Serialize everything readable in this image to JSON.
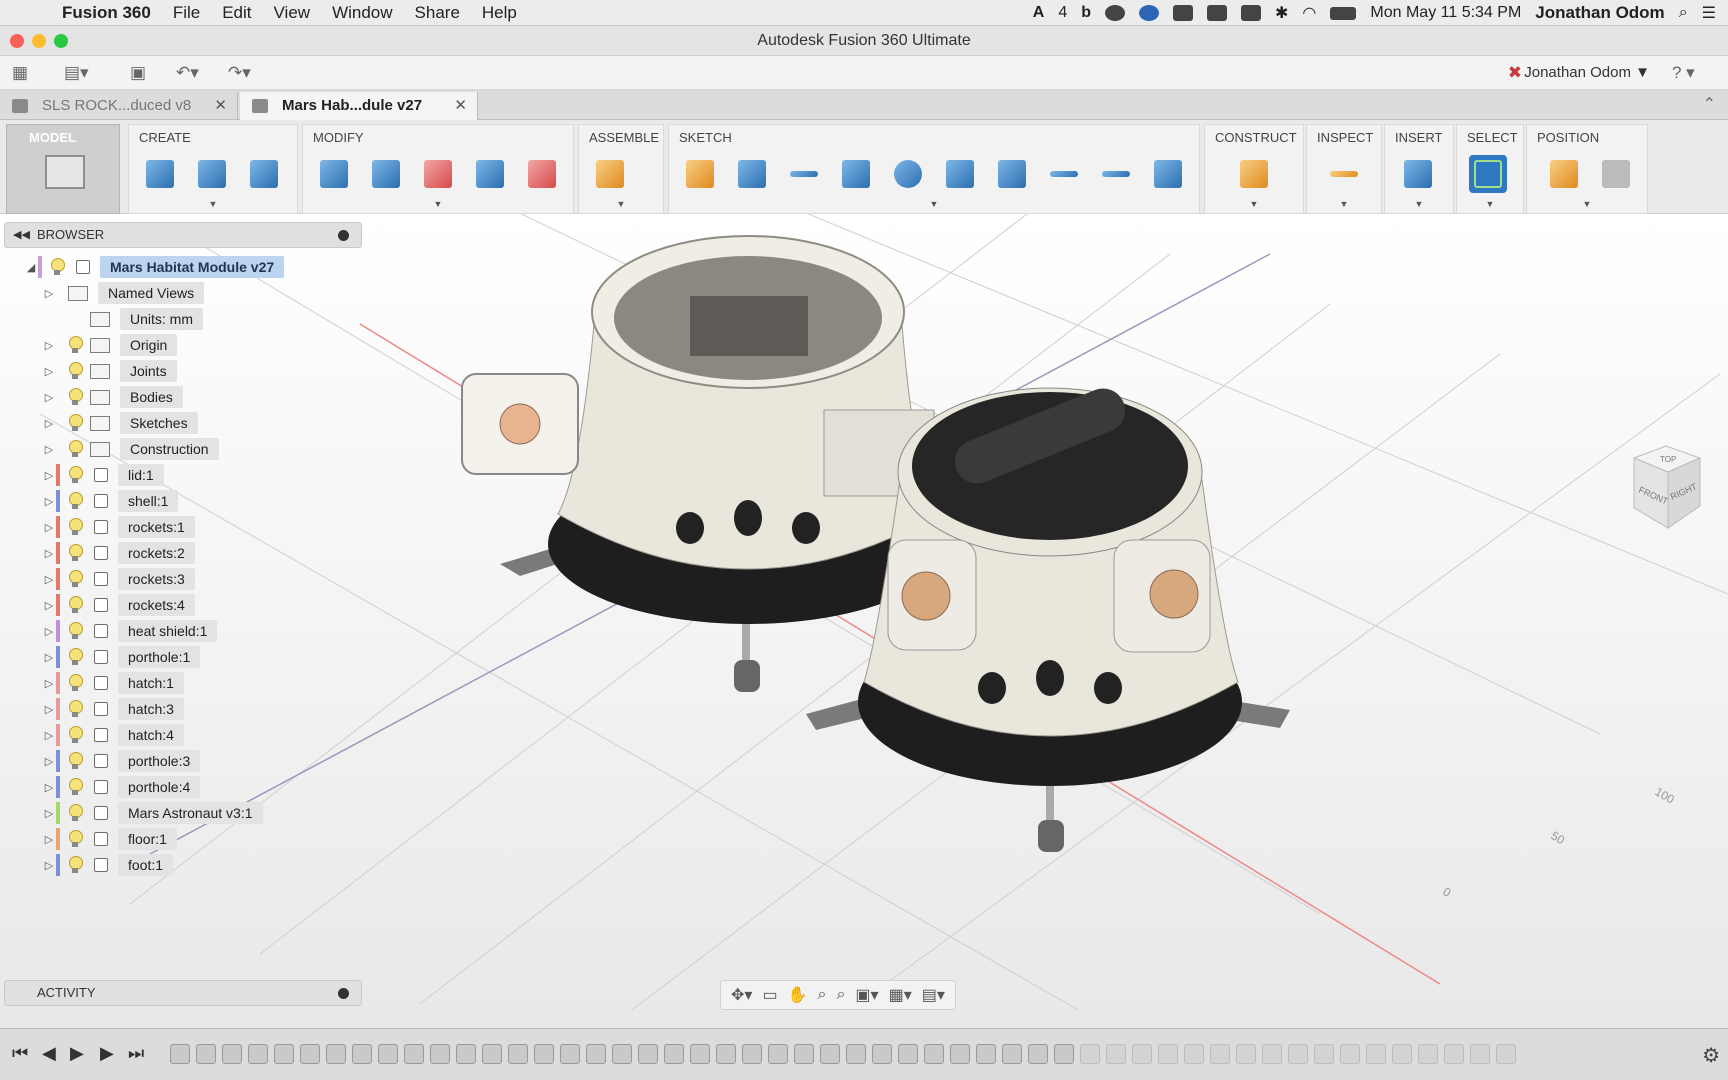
{
  "menubar": {
    "app_name": "Fusion 360",
    "menus": [
      "File",
      "Edit",
      "View",
      "Window",
      "Share",
      "Help"
    ],
    "status_num": "4",
    "datetime": "Mon May 11  5:34 PM",
    "user": "Jonathan Odom"
  },
  "window": {
    "title": "Autodesk Fusion 360 Ultimate"
  },
  "toolbar": {
    "user_menu": "Jonathan Odom ▼",
    "help": "? ▾"
  },
  "doc_tabs": [
    {
      "label": "SLS ROCK...duced v8",
      "close": "✕"
    },
    {
      "label": "Mars Hab...dule v27",
      "close": "✕"
    }
  ],
  "ribbon": {
    "workspace": "MODEL",
    "groups": [
      {
        "label": "CREATE"
      },
      {
        "label": "MODIFY"
      },
      {
        "label": "ASSEMBLE"
      },
      {
        "label": "SKETCH"
      },
      {
        "label": "CONSTRUCT"
      },
      {
        "label": "INSPECT"
      },
      {
        "label": "INSERT"
      },
      {
        "label": "SELECT"
      },
      {
        "label": "POSITION"
      }
    ]
  },
  "browser": {
    "title": "BROWSER",
    "root": "Mars Habitat Module v27",
    "items": [
      {
        "label": "Named Views",
        "type": "folder",
        "bulb": false,
        "color": ""
      },
      {
        "label": "Units: mm",
        "type": "units",
        "bulb": false,
        "color": ""
      },
      {
        "label": "Origin",
        "type": "folder",
        "bulb": true,
        "color": ""
      },
      {
        "label": "Joints",
        "type": "folder",
        "bulb": true,
        "color": ""
      },
      {
        "label": "Bodies",
        "type": "folder",
        "bulb": true,
        "color": ""
      },
      {
        "label": "Sketches",
        "type": "folder",
        "bulb": true,
        "color": ""
      },
      {
        "label": "Construction",
        "type": "folder",
        "bulb": true,
        "color": ""
      },
      {
        "label": "lid:1",
        "type": "component",
        "bulb": true,
        "color": "#e07a6a"
      },
      {
        "label": "shell:1",
        "type": "component",
        "bulb": true,
        "color": "#7e8ed8"
      },
      {
        "label": "rockets:1",
        "type": "component",
        "bulb": true,
        "color": "#e07a6a"
      },
      {
        "label": "rockets:2",
        "type": "component",
        "bulb": true,
        "color": "#e07a6a"
      },
      {
        "label": "rockets:3",
        "type": "component",
        "bulb": true,
        "color": "#e07a6a"
      },
      {
        "label": "rockets:4",
        "type": "component",
        "bulb": true,
        "color": "#e07a6a"
      },
      {
        "label": "heat shield:1",
        "type": "component",
        "bulb": true,
        "color": "#c48ed8"
      },
      {
        "label": "porthole:1",
        "type": "component",
        "bulb": true,
        "color": "#7e8ed8"
      },
      {
        "label": "hatch:1",
        "type": "component",
        "bulb": true,
        "color": "#e89a9a"
      },
      {
        "label": "hatch:3",
        "type": "component",
        "bulb": true,
        "color": "#e89a9a"
      },
      {
        "label": "hatch:4",
        "type": "component",
        "bulb": true,
        "color": "#e89a9a"
      },
      {
        "label": "porthole:3",
        "type": "component",
        "bulb": true,
        "color": "#7e8ed8"
      },
      {
        "label": "porthole:4",
        "type": "component",
        "bulb": true,
        "color": "#7e8ed8"
      },
      {
        "label": "Mars Astronaut v3:1",
        "type": "component",
        "bulb": true,
        "color": "#a7d86a"
      },
      {
        "label": "floor:1",
        "type": "component",
        "bulb": true,
        "color": "#e8a46a"
      },
      {
        "label": "foot:1",
        "type": "component",
        "bulb": true,
        "color": "#7e8ed8"
      }
    ]
  },
  "activity": {
    "title": "ACTIVITY"
  },
  "viewcube": {
    "top": "TOP",
    "front": "FRONT",
    "right": "RIGHT"
  },
  "grid_labels": [
    "100",
    "50",
    "0"
  ],
  "colors": {
    "accent": "#2f79c2",
    "root_highlight": "#bcd4f0"
  }
}
